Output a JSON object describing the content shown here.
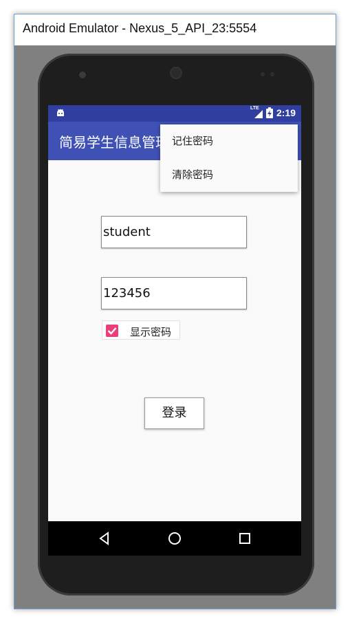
{
  "window": {
    "title": "Android Emulator - Nexus_5_API_23:5554"
  },
  "status_bar": {
    "time": "2:19",
    "network": "LTE",
    "icons": [
      "android-icon",
      "signal-icon",
      "battery-charging-icon"
    ]
  },
  "app_bar": {
    "title": "简易学生信息管理"
  },
  "overflow_menu": {
    "items": [
      {
        "label": "记住密码"
      },
      {
        "label": "清除密码"
      }
    ]
  },
  "form": {
    "username": {
      "value": "student"
    },
    "password": {
      "value": "123456"
    },
    "show_password": {
      "label": "显示密码",
      "checked": true
    },
    "login_button": {
      "label": "登录"
    }
  },
  "nav_bar": {
    "icons": [
      "back-icon",
      "home-icon",
      "recents-icon"
    ]
  },
  "colors": {
    "status_bar": "#303f9f",
    "app_bar": "#3f51b5",
    "accent": "#e94079"
  }
}
